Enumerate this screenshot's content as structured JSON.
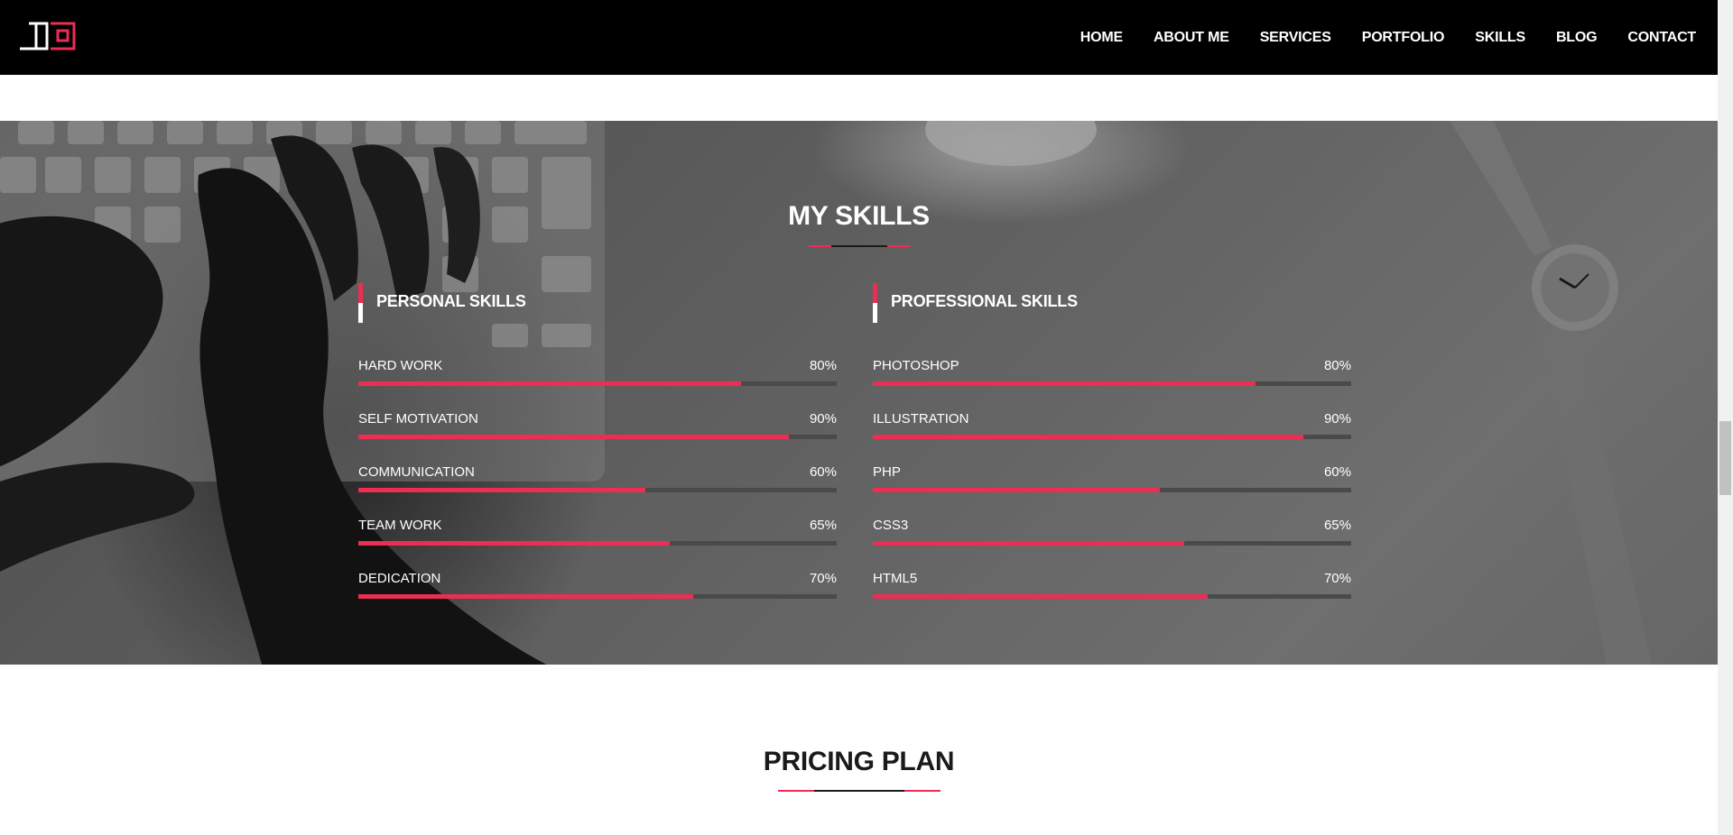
{
  "header": {
    "logo_icon": "jd-logo-icon",
    "nav": [
      "HOME",
      "ABOUT ME",
      "SERVICES",
      "PORTFOLIO",
      "SKILLS",
      "BLOG",
      "CONTACT"
    ]
  },
  "skills_section": {
    "title": "MY SKILLS",
    "personal": {
      "heading": "PERSONAL SKILLS",
      "items": [
        {
          "name": "HARD WORK",
          "percent_label": "80%",
          "value": 80
        },
        {
          "name": "SELF MOTIVATION",
          "percent_label": "90%",
          "value": 90
        },
        {
          "name": "COMMUNICATION",
          "percent_label": "60%",
          "value": 60
        },
        {
          "name": "TEAM WORK",
          "percent_label": "65%",
          "value": 65
        },
        {
          "name": "DEDICATION",
          "percent_label": "70%",
          "value": 70
        }
      ]
    },
    "professional": {
      "heading": "PROFESSIONAL SKILLS",
      "items": [
        {
          "name": "PHOTOSHOP",
          "percent_label": "80%",
          "value": 80
        },
        {
          "name": "ILLUSTRATION",
          "percent_label": "90%",
          "value": 90
        },
        {
          "name": "PHP",
          "percent_label": "60%",
          "value": 60
        },
        {
          "name": "CSS3",
          "percent_label": "65%",
          "value": 65
        },
        {
          "name": "HTML5",
          "percent_label": "70%",
          "value": 70
        }
      ]
    }
  },
  "pricing_section": {
    "title": "PRICING PLAN"
  },
  "colors": {
    "accent": "#ec2d54",
    "header_bg": "#000000",
    "track": "#4a4a4a"
  }
}
